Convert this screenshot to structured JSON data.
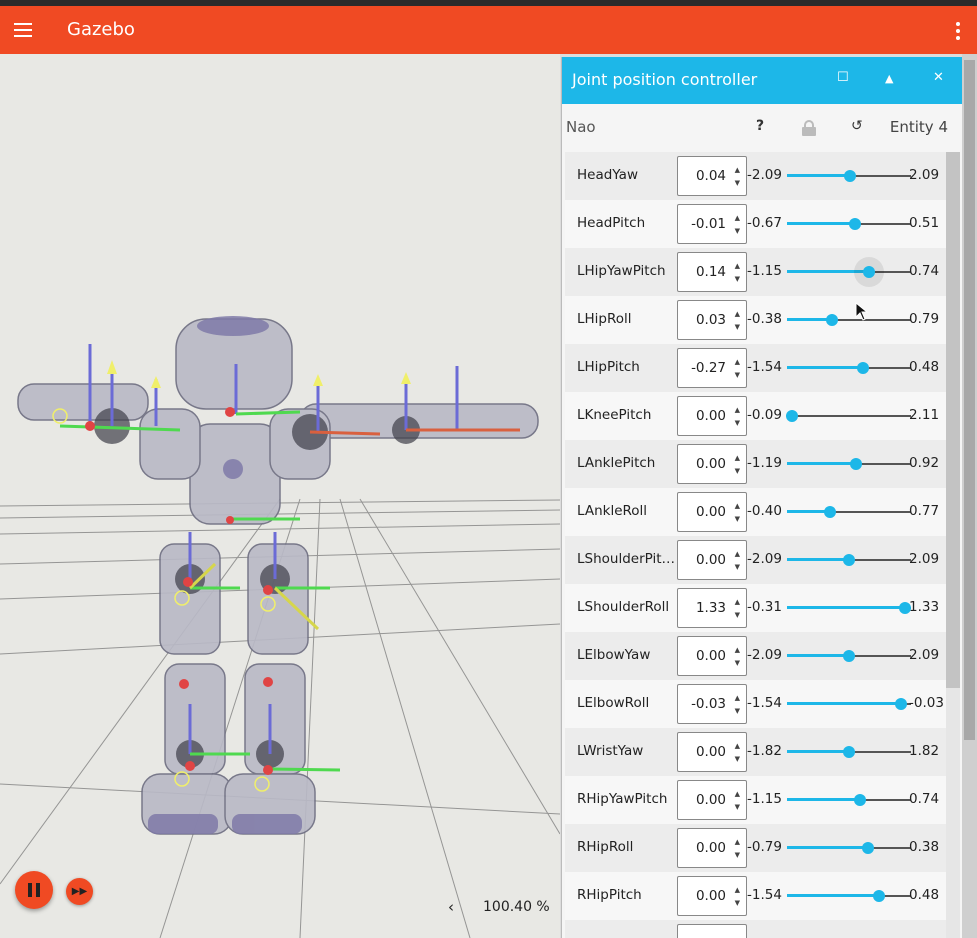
{
  "app": {
    "title": "Gazebo"
  },
  "panel": {
    "title": "Joint position controller",
    "model_name": "Nao",
    "help_label": "?",
    "reset_label": "↺",
    "entity_label": "Entity 4",
    "joints": [
      {
        "name": "HeadYaw",
        "value": "0.04",
        "min": "-2.09",
        "max": "2.09",
        "position": 0.51
      },
      {
        "name": "HeadPitch",
        "value": "-0.01",
        "min": "-0.67",
        "max": "0.51",
        "position": 0.55
      },
      {
        "name": "LHipYawPitch",
        "value": "0.14",
        "min": "-1.15",
        "max": "0.74",
        "position": 0.66
      },
      {
        "name": "LHipRoll",
        "value": "0.03",
        "min": "-0.38",
        "max": "0.79",
        "position": 0.36
      },
      {
        "name": "LHipPitch",
        "value": "-0.27",
        "min": "-1.54",
        "max": "0.48",
        "position": 0.61
      },
      {
        "name": "LKneePitch",
        "value": "0.00",
        "min": "-0.09",
        "max": "2.11",
        "position": 0.04
      },
      {
        "name": "LAnklePitch",
        "value": "0.00",
        "min": "-1.19",
        "max": "0.92",
        "position": 0.56
      },
      {
        "name": "LAnkleRoll",
        "value": "0.00",
        "min": "-0.40",
        "max": "0.77",
        "position": 0.35
      },
      {
        "name": "LShoulderPitch",
        "value": "0.00",
        "min": "-2.09",
        "max": "2.09",
        "position": 0.5
      },
      {
        "name": "LShoulderRoll",
        "value": "1.33",
        "min": "-0.31",
        "max": "1.33",
        "position": 0.95
      },
      {
        "name": "LElbowYaw",
        "value": "0.00",
        "min": "-2.09",
        "max": "2.09",
        "position": 0.5
      },
      {
        "name": "LElbowRoll",
        "value": "-0.03",
        "min": "-1.54",
        "max": "-0.03",
        "position": 0.92
      },
      {
        "name": "LWristYaw",
        "value": "0.00",
        "min": "-1.82",
        "max": "1.82",
        "position": 0.5
      },
      {
        "name": "RHipYawPitch",
        "value": "0.00",
        "min": "-1.15",
        "max": "0.74",
        "position": 0.59
      },
      {
        "name": "RHipRoll",
        "value": "0.00",
        "min": "-0.79",
        "max": "0.38",
        "position": 0.65
      },
      {
        "name": "RHipPitch",
        "value": "0.00",
        "min": "-1.54",
        "max": "0.48",
        "position": 0.74
      }
    ]
  },
  "scene": {
    "real_time_factor": "100.40 %"
  },
  "colors": {
    "appbar": "#f04a23",
    "panel_header": "#1db7e8",
    "slider": "#1db7e8"
  }
}
